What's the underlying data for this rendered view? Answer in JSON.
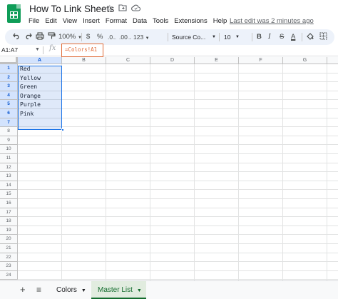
{
  "app": {
    "title": "How To Link Sheets",
    "last_edit": "Last edit was 2 minutes ago",
    "menu": [
      "File",
      "Edit",
      "View",
      "Insert",
      "Format",
      "Data",
      "Tools",
      "Extensions",
      "Help"
    ]
  },
  "toolbar": {
    "zoom": "100%",
    "currency": "$",
    "percent": "%",
    "decrease_decimal": ".0",
    "increase_decimal": ".00",
    "more_formats": "123",
    "font": "Source Co...",
    "font_size": "10",
    "bold": "B",
    "italic": "I",
    "strikethrough": "S",
    "text_color": "A"
  },
  "formula_bar": {
    "name_box": "A1:A7",
    "fx": "fx",
    "formula": "=Colors!A1"
  },
  "grid": {
    "columns": [
      "A",
      "B",
      "C",
      "D",
      "E",
      "F",
      "G",
      "H"
    ],
    "rows": [
      "1",
      "2",
      "3",
      "4",
      "5",
      "6",
      "7",
      "8",
      "9",
      "10",
      "11",
      "12",
      "13",
      "14",
      "15",
      "16",
      "17",
      "18",
      "19",
      "20",
      "21",
      "22",
      "23",
      "24"
    ],
    "cells_a": [
      "Red",
      "Yellow",
      "Green",
      "Orange",
      "Purple",
      "Pink"
    ]
  },
  "sheets": {
    "add": "+",
    "all_sheets": "≡",
    "tabs": [
      {
        "label": "Colors",
        "active": false
      },
      {
        "label": "Master List",
        "active": true
      }
    ]
  },
  "colors": {
    "accent": "#1a73e8",
    "formula_highlight": "#e06a36",
    "active_tab": "#146c2e"
  }
}
